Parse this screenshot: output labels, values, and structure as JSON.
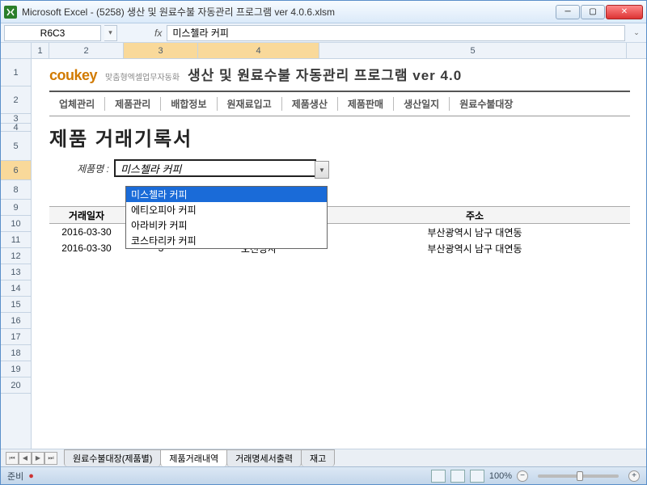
{
  "window": {
    "app": "Microsoft Excel",
    "file": "(5258) 생산 및 원료수불 자동관리 프로그램 ver 4.0.6.xlsm"
  },
  "formula_bar": {
    "cell_ref": "R6C3",
    "fx": "fx",
    "value": "미스첼라 커피"
  },
  "columns": [
    "1",
    "2",
    "3",
    "4",
    "5"
  ],
  "row_numbers": [
    "1",
    "2",
    "3",
    "4",
    "5",
    "6",
    "8",
    "9",
    "10",
    "11",
    "12",
    "13",
    "14",
    "15",
    "16",
    "17",
    "18",
    "19",
    "20"
  ],
  "logo": {
    "brand": "coukey",
    "tagline": "맞춤형엑셀업무자동화",
    "title": "생산 및 원료수불 자동관리 프로그램 ver 4.0"
  },
  "menu": [
    "업체관리",
    "제품관리",
    "배합정보",
    "원재료입고",
    "제품생산",
    "제품판매",
    "생산일지",
    "원료수불대장"
  ],
  "doc_title": "제품 거래기록서",
  "product": {
    "label": "제품명 :",
    "value": "미스첼라 커피",
    "options": [
      "미스첼라 커피",
      "에티오피아 커피",
      "아라비카 커피",
      "코스타리카 커피"
    ]
  },
  "table": {
    "headers": [
      "거래일자",
      "",
      "",
      "주소"
    ],
    "rows": [
      {
        "date": "2016-03-30",
        "qty": "",
        "company": "",
        "addr": "부산광역시 남구 대연동"
      },
      {
        "date": "2016-03-30",
        "qty": "3",
        "company": "오천상사",
        "addr": "부산광역시 남구 대연동"
      }
    ]
  },
  "sheet_tabs": [
    "원료수불대장(제품별)",
    "제품거래내역",
    "거래명세서출력",
    "재고"
  ],
  "active_tab_index": 1,
  "status": {
    "ready": "준비",
    "rec": "●",
    "zoom": "100%"
  }
}
